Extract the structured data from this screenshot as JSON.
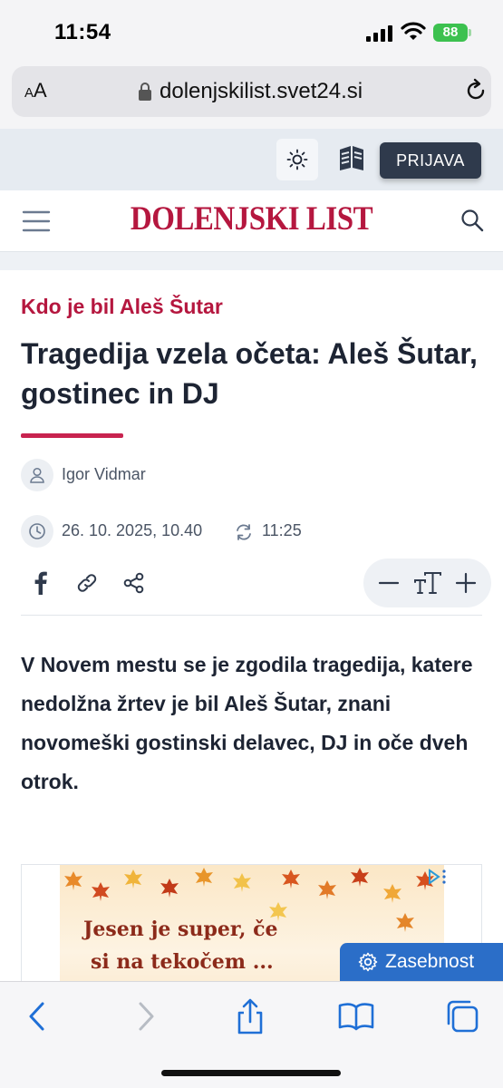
{
  "status_bar": {
    "time": "11:54",
    "battery": "88"
  },
  "browser": {
    "aa_label_small": "A",
    "aa_label_large": "A",
    "url": "dolenjskilist.svet24.si"
  },
  "site": {
    "login_label": "PRIJAVA",
    "logo_text": "DOLENJSKI LIST",
    "brand_color": "#b5173f"
  },
  "article": {
    "kicker": "Kdo je bil Aleš Šutar",
    "headline": "Tragedija vzela očeta: Aleš Šutar, gostinec in DJ",
    "author": "Igor Vidmar",
    "published": "26. 10. 2025, 10.40",
    "updated": "11:25",
    "lead": "V Novem mestu se je zgodila tragedija, katere nedolžna žrtev je bil Aleš Šutar, znani novomeški gostinski delavec, DJ in oče dveh otrok."
  },
  "ad": {
    "line1": "Jesen je super, če",
    "line2": "si na tekočem ..."
  },
  "privacy_label": "Zasebnost",
  "icons": {
    "theme": "sun-icon",
    "eread": "e-reader-icon",
    "menu": "hamburger-menu-icon",
    "search": "search-icon",
    "author": "user-icon",
    "date": "clock-icon",
    "updated": "refresh-icon",
    "share": [
      "facebook-icon",
      "link-icon",
      "share-icon"
    ],
    "font": [
      "minus-icon",
      "text-size-icon",
      "plus-icon"
    ],
    "toolbar": [
      "back-icon",
      "forward-icon",
      "share-icon",
      "bookmarks-icon",
      "tabs-icon"
    ]
  }
}
